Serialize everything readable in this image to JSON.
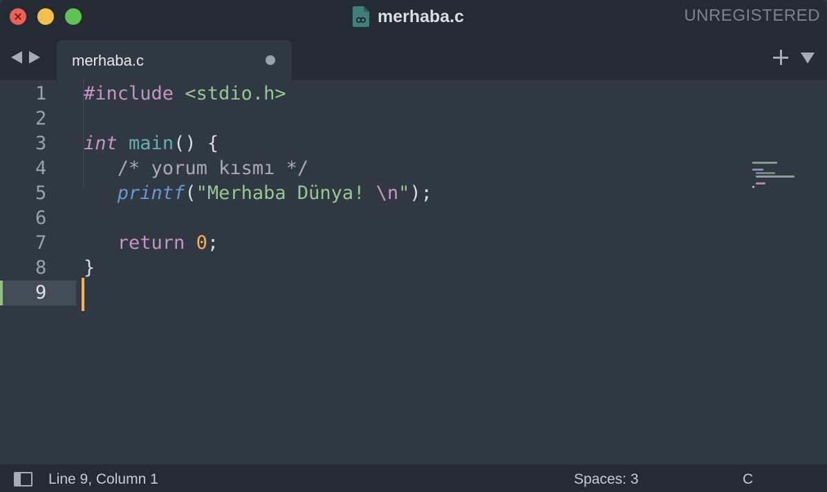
{
  "window": {
    "title": "merhaba.c",
    "registration": "UNREGISTERED"
  },
  "tabs": [
    {
      "label": "merhaba.c",
      "dirty": true
    }
  ],
  "editor": {
    "line_numbers": [
      "1",
      "2",
      "3",
      "4",
      "5",
      "6",
      "7",
      "8",
      "9"
    ],
    "current_line": "9",
    "lines": [
      {
        "parts": [
          "#include",
          " ",
          "<stdio.h>"
        ]
      },
      {
        "parts": []
      },
      {
        "parts": [
          "int",
          " ",
          "main",
          "() {"
        ]
      },
      {
        "parts": [
          "   ",
          "/* yorum kısmı */"
        ]
      },
      {
        "parts": [
          "   ",
          "printf",
          "(",
          "\"Merhaba Dünya! ",
          "\\n",
          "\"",
          ");"
        ]
      },
      {
        "parts": []
      },
      {
        "parts": [
          "   ",
          "return",
          " ",
          "0",
          ";"
        ]
      },
      {
        "parts": [
          "}"
        ]
      },
      {
        "parts": []
      }
    ]
  },
  "status": {
    "position": "Line 9, Column 1",
    "indentation": "Spaces: 3",
    "syntax": "C"
  },
  "icons": {
    "file": "c-file-icon",
    "nav_back": "nav-back-icon",
    "nav_forward": "nav-forward-icon",
    "new_tab": "plus-icon",
    "tab_menu": "dropdown-icon",
    "sidebar": "sidebar-toggle-icon"
  },
  "colors": {
    "background": "#303841",
    "chrome": "#252b33",
    "keyword": "#c695c6",
    "string": "#99c794",
    "function": "#5fb3b3",
    "call": "#6699cc",
    "number": "#f9ae58",
    "cursor": "#f9ae58",
    "gutter_marker": "#8fc37a"
  }
}
